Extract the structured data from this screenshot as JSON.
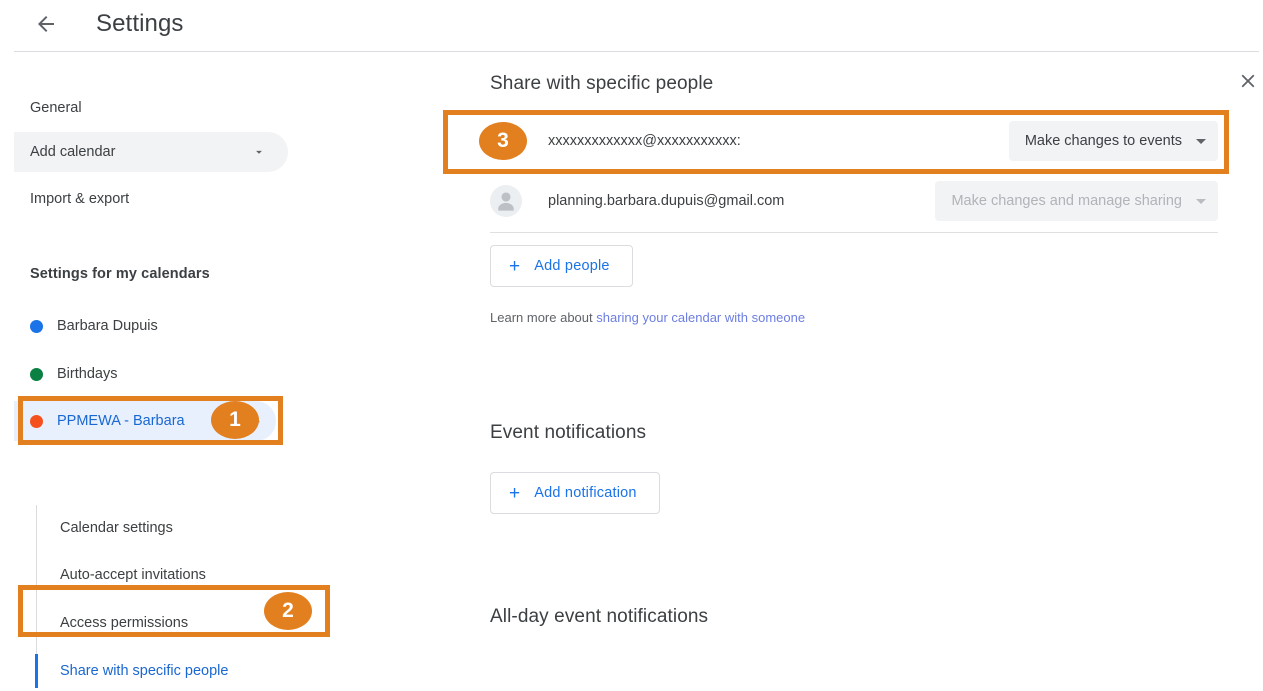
{
  "header": {
    "back_icon": "back-arrow-icon",
    "title": "Settings"
  },
  "sidebar": {
    "top_items": [
      {
        "label": "General",
        "icon": null
      },
      {
        "label": "Add calendar",
        "icon": "chevron-down-icon",
        "selected": true
      },
      {
        "label": "Import & export",
        "icon": null
      }
    ],
    "section_heading": "Settings for my calendars",
    "calendars": [
      {
        "label": "Barbara Dupuis",
        "dot_color": "#1a73e8"
      },
      {
        "label": "Birthdays",
        "dot_color": "#0b8043"
      },
      {
        "label": "PPMEWA - Barbara",
        "dot_color": "#f4511e",
        "expanded": true,
        "icon": "chevron-up-icon"
      }
    ],
    "sub_items": [
      {
        "label": "Calendar settings"
      },
      {
        "label": "Auto-accept invitations"
      },
      {
        "label": "Access permissions"
      },
      {
        "label": "Share with specific people",
        "active": true
      }
    ]
  },
  "main": {
    "share_section": {
      "title": "Share with specific people",
      "rows": [
        {
          "email": "xxxxxxxxxxxxx@xxxxxxxxxxx:",
          "permission": "Make changes to events",
          "permission_disabled": false,
          "avatar_icon": null,
          "remove_icon": "close-icon"
        },
        {
          "email": "planning.barbara.dupuis@gmail.com",
          "permission": "Make changes and manage sharing",
          "permission_disabled": true,
          "avatar_icon": "person-avatar-icon",
          "remove_icon": null
        }
      ],
      "add_people_label": "Add people",
      "add_people_icon": "plus-icon",
      "learn_more_prefix": "Learn more about ",
      "learn_more_link": "sharing your calendar with someone"
    },
    "event_notifications": {
      "title": "Event notifications",
      "add_notification_label": "Add notification",
      "add_notification_icon": "plus-icon"
    },
    "all_day_notifications": {
      "title": "All-day event notifications"
    }
  },
  "annotations": {
    "accent_color": "#e2801f",
    "badges": [
      {
        "number": "1",
        "target": "sidebar-item-ppmewa"
      },
      {
        "number": "2",
        "target": "sidebar-subitem-share-with-specific-people"
      },
      {
        "number": "3",
        "target": "share-row-1"
      }
    ]
  },
  "colors": {
    "link_blue": "#1a73e8",
    "selected_blue_bg": "#e8f0fe",
    "text_primary": "#3c4043",
    "text_secondary": "#5f6368",
    "field_grey": "#f1f3f4",
    "annotation_orange": "#e2801f"
  }
}
